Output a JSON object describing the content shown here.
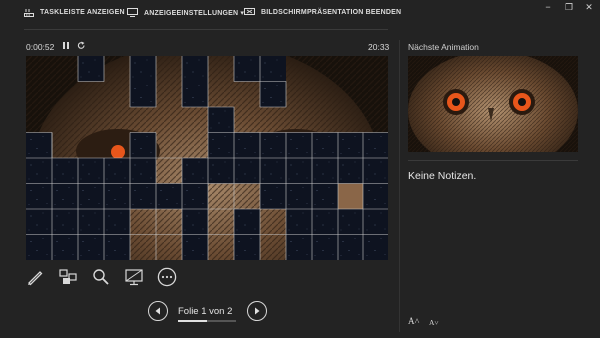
{
  "toolbar": {
    "taskbar_label": "TASKLEISTE ANZEIGEN",
    "display_settings_label": "ANZEIGEEINSTELLUNGEN ▾",
    "end_show_label": "BILDSCHIRMPRÄSENTATION BEENDEN"
  },
  "window_controls": {
    "minimize": "−",
    "restore": "❐",
    "close": "✕"
  },
  "presenter": {
    "elapsed_time": "0:00:52",
    "clock": "20:33",
    "slide_counter": "Folie 1 von 2",
    "progress": 0.5
  },
  "side_panel": {
    "next_label": "Nächste Animation",
    "notes_text": "Keine Notizen.",
    "font_larger": "A˄",
    "font_smaller": "A˅"
  },
  "tools": [
    "pen-icon",
    "slides-grid-icon",
    "zoom-icon",
    "screen-icon",
    "more-options-icon"
  ],
  "colors": {
    "background": "#232323",
    "tile": "#0e1320",
    "grid_line": "#c9c9c9",
    "eye": "#e8561b"
  }
}
